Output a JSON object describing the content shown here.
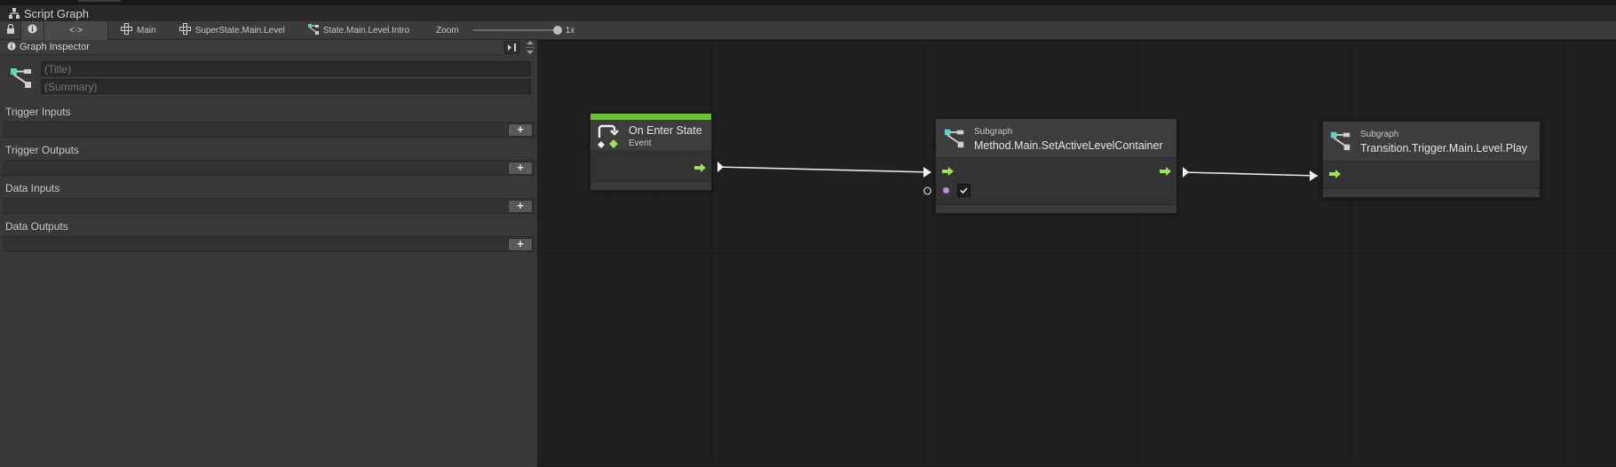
{
  "window": {
    "title": "Script Graph"
  },
  "toolbar": {
    "code_label": "<·>",
    "breadcrumbs": [
      "Main",
      "SuperState.Main.Level",
      "State.Main.Level.Intro"
    ],
    "zoom_label": "Zoom",
    "zoom_value": "1x",
    "zoom_level": 1.0
  },
  "inspector": {
    "header": "Graph Inspector",
    "title_placeholder": "(Title)",
    "summary_placeholder": "(Summary)",
    "sections": [
      "Trigger Inputs",
      "Trigger Outputs",
      "Data Inputs",
      "Data Outputs"
    ],
    "add_label": "+"
  },
  "nodes": {
    "enter": {
      "name": "On Enter State",
      "sub": "Event"
    },
    "sub1": {
      "sub": "Subgraph",
      "name": "Method.Main.SetActiveLevelContainer"
    },
    "sub2": {
      "sub": "Subgraph",
      "name": "Transition.Trigger.Main.Level.Play"
    }
  },
  "colors": {
    "event_bar": "#6fbf3f",
    "flow_port": "#9ce05a",
    "subgraph_icon": "#5fd3c6",
    "data_port": "#b48ee0"
  }
}
